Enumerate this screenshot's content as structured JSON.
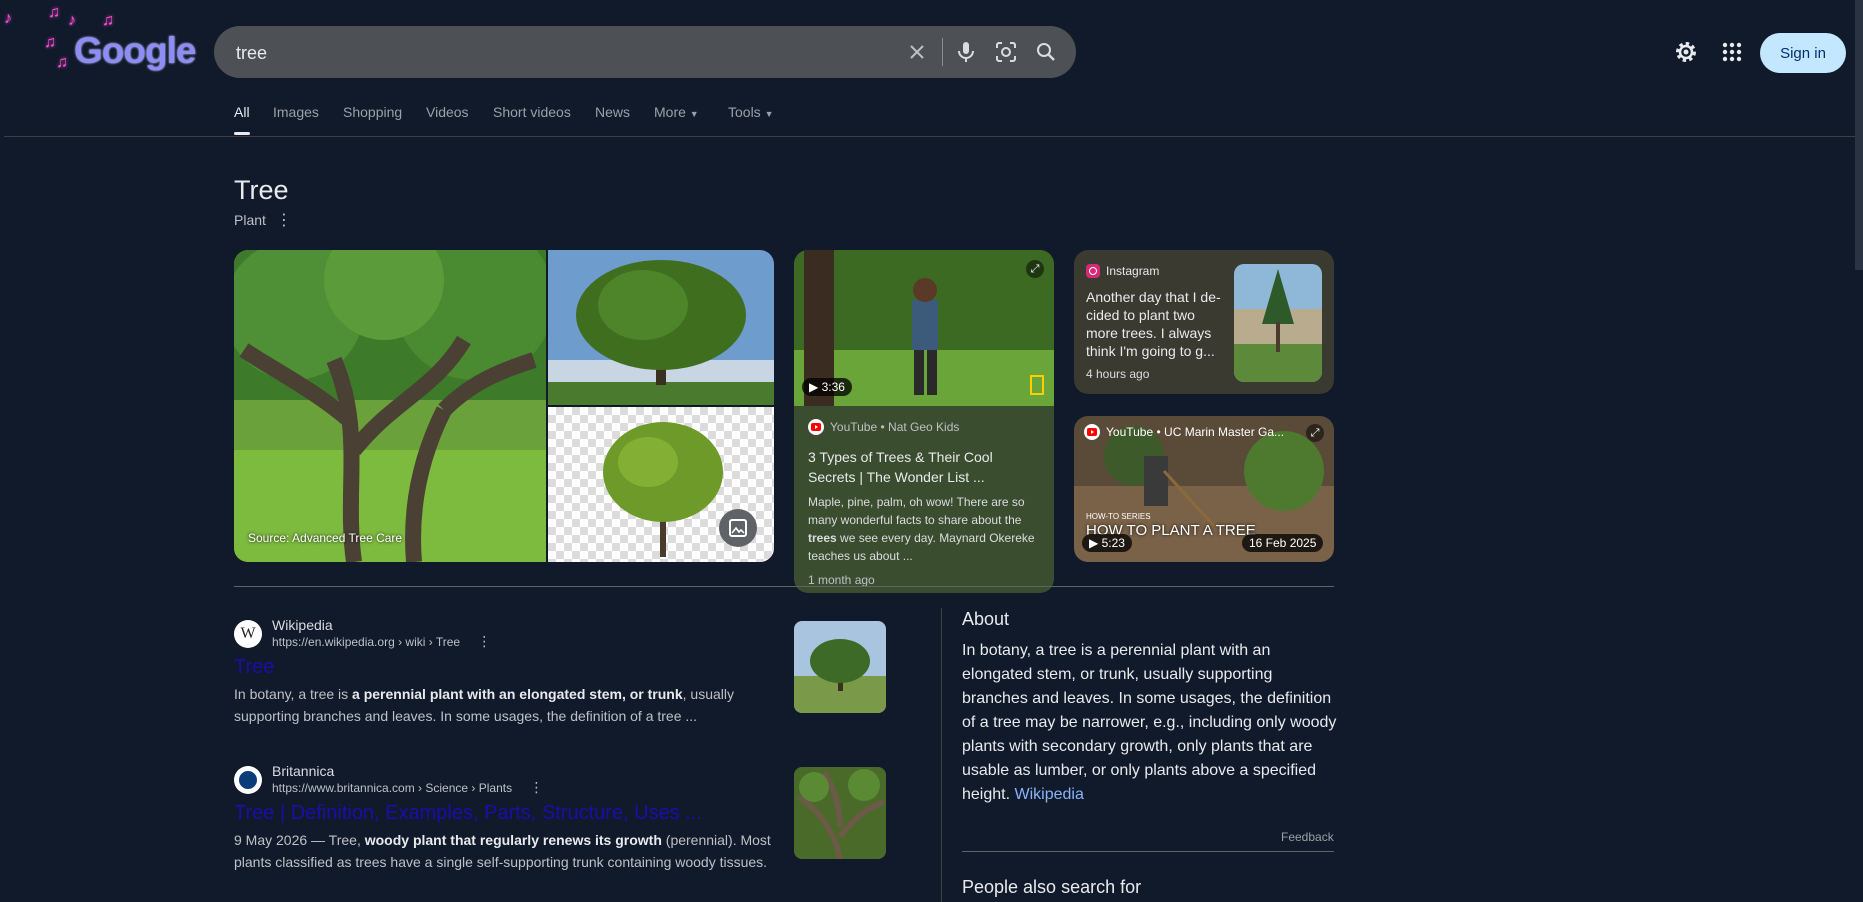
{
  "header": {
    "logo_text": "Google",
    "search_value": "tree",
    "signin_label": "Sign in",
    "icons": [
      "clear-icon",
      "mic-icon",
      "lens-icon",
      "search-icon",
      "settings-icon",
      "apps-icon"
    ]
  },
  "tabs": [
    {
      "label": "All",
      "active": true
    },
    {
      "label": "Images"
    },
    {
      "label": "Shopping"
    },
    {
      "label": "Videos"
    },
    {
      "label": "Short videos"
    },
    {
      "label": "News"
    },
    {
      "label": "More"
    },
    {
      "label": "Tools"
    }
  ],
  "entity": {
    "title": "Tree",
    "subtitle": "Plant",
    "image_source": "Source: Advanced Tree Care"
  },
  "video_card": {
    "duration": "3:36",
    "source": "YouTube • Nat Geo Kids",
    "title": "3 Types of Trees & Their Cool Secrets | The Wonder List ...",
    "snippet_pre": "Maple, pine, palm, oh wow! There are so many wonderful facts to share about the",
    "snippet_bold": "trees",
    "snippet_post": "we see every day. Maynard Okereke teaches us about ...",
    "age": "1 month ago"
  },
  "instagram_card": {
    "source": "Instagram",
    "text": "Another day that I de-cided to plant two more trees. I always think I'm going to g...",
    "age": "4 hours ago"
  },
  "yt_card": {
    "source": "YouTube • UC Marin Master Ga...",
    "overlay_small": "HOW-TO SERIES",
    "overlay_big": "HOW TO PLANT A TREE",
    "duration": "5:23",
    "date": "16 Feb 2025"
  },
  "results": [
    {
      "site": "Wikipedia",
      "url": "https://en.wikipedia.org › wiki › Tree",
      "title": "Tree",
      "snippet_pre": "In botany, a tree is",
      "snippet_bold": "a perennial plant with an elongated stem, or trunk",
      "snippet_post": ", usually supporting branches and leaves. In some usages, the definition of a tree ..."
    },
    {
      "site": "Britannica",
      "url": "https://www.britannica.com › Science › Plants",
      "title": "Tree | Definition, Examples, Parts, Structure, Uses ...",
      "snippet_pre": "9 May 2026 — Tree,",
      "snippet_bold": "woody plant that regularly renews its growth",
      "snippet_post": "(perennial). Most plants classified as trees have a single self-supporting trunk containing woody tissues."
    }
  ],
  "about": {
    "heading": "About",
    "text": "In botany, a tree is a perennial plant with an elongated stem, or trunk, usually supporting branches and leaves. In some usages, the definition of a tree may be narrower, e.g., including only woody plants with secondary growth, only plants that are usable as lumber, or only plants above a specified height.",
    "link": "Wikipedia",
    "feedback": "Feedback",
    "people_also": "People also search for"
  }
}
